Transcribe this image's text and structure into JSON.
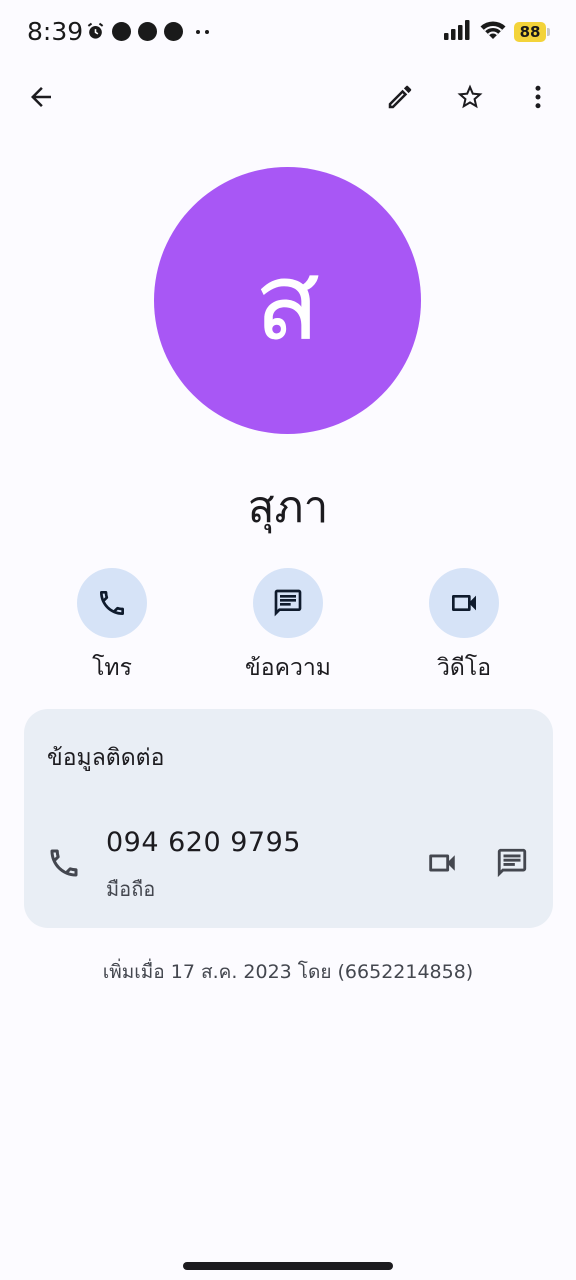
{
  "status_bar": {
    "time": "8:39",
    "battery": "88",
    "notification_icons": [
      "alarm-icon",
      "line-icon",
      "leaf-icon",
      "line-icon"
    ]
  },
  "app_bar": {
    "icons": [
      "back-arrow-icon",
      "edit-pencil-icon",
      "star-outline-icon",
      "more-vert-icon"
    ]
  },
  "contact": {
    "avatar_letter": "ส",
    "avatar_color": "#a857f5",
    "name": "สุภา"
  },
  "actions": [
    {
      "label": "โทร",
      "icon": "phone-icon"
    },
    {
      "label": "ข้อความ",
      "icon": "message-icon"
    },
    {
      "label": "วิดีโอ",
      "icon": "videocam-icon"
    }
  ],
  "contact_info": {
    "title": "ข้อมูลติดต่อ",
    "phone_number": "094 620 9795",
    "phone_type": "มือถือ"
  },
  "added_info": "เพิ่มเมื่อ 17 ส.ค. 2023 โดย (6652214858)",
  "colors": {
    "action_circle": "#d6e3f7",
    "card_background": "#e9eef5",
    "battery_badge": "#f3d33a"
  }
}
